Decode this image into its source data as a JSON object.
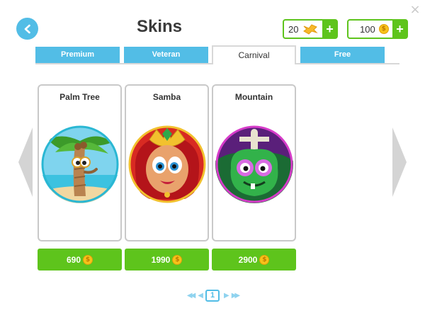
{
  "header": {
    "title": "Skins",
    "tickets": "20",
    "coins": "100",
    "plus_label": "+",
    "close_label": "×"
  },
  "tabs": [
    {
      "label": "Premium",
      "active": false
    },
    {
      "label": "Veteran",
      "active": false
    },
    {
      "label": "Carnival",
      "active": true
    },
    {
      "label": "Free",
      "active": false
    }
  ],
  "skins": [
    {
      "name": "Palm Tree",
      "price": "690"
    },
    {
      "name": "Samba",
      "price": "1990"
    },
    {
      "name": "Mountain",
      "price": "2900"
    }
  ],
  "pager": {
    "first": "◀◀",
    "prev": "◀",
    "current_page": "1",
    "next": "▶",
    "last": "▶▶"
  },
  "coin_symbol": "$",
  "colors": {
    "accent_blue": "#52bde6",
    "buy_green": "#5ec41c",
    "coin_gold": "#f7c21a"
  },
  "icons": {
    "back": "chevron-left-icon",
    "close": "close-icon",
    "ticket": "ticket-icon",
    "coin": "coin-icon",
    "side_prev": "arrow-left-icon",
    "side_next": "arrow-right-icon"
  }
}
